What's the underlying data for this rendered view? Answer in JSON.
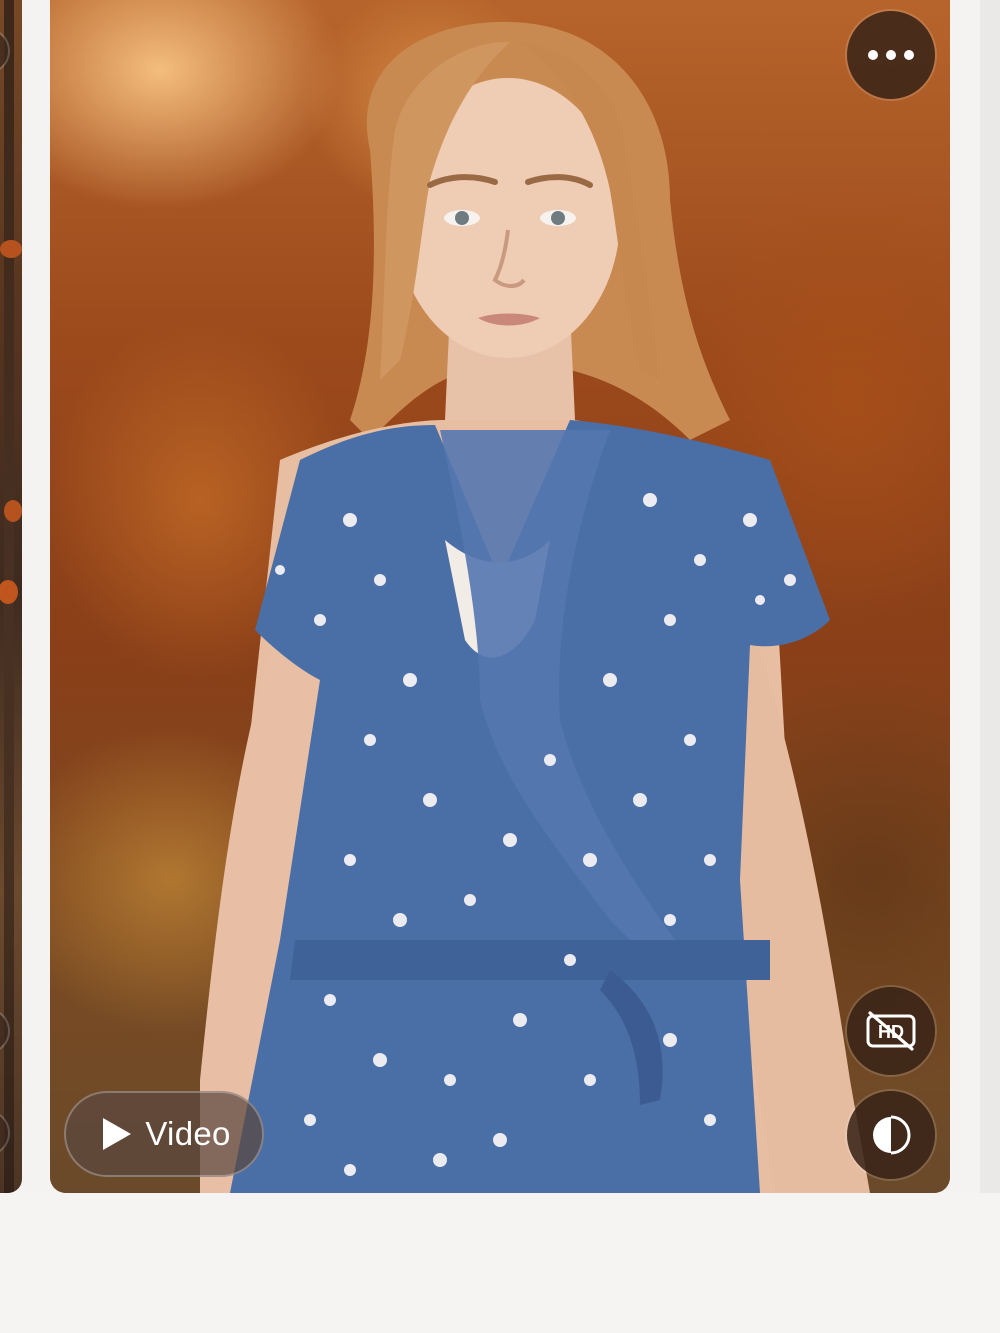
{
  "viewer": {
    "video_button": {
      "label": "Video",
      "icon": "play-icon"
    },
    "toolbar": {
      "more_icon": "more-horizontal-icon",
      "hd_off_icon": "hd-off-icon",
      "contrast_icon": "contrast-icon"
    }
  },
  "colors": {
    "button_bg": "#3a2418",
    "video_button_bg": "#5c4840",
    "page_bg": "#f4f3f2"
  }
}
